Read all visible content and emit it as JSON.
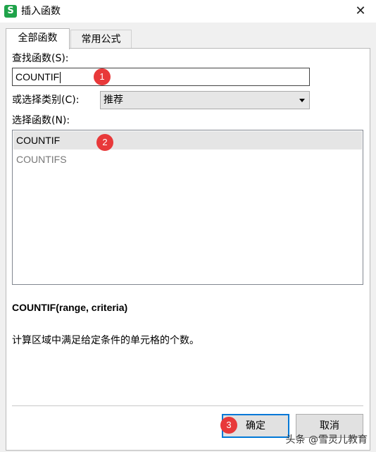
{
  "window": {
    "app_icon": "S",
    "title": "插入函数",
    "close_glyph": "✕"
  },
  "tabs": [
    {
      "label": "全部函数",
      "active": true
    },
    {
      "label": "常用公式",
      "active": false
    }
  ],
  "search": {
    "label": "查找函数(S):",
    "value": "COUNTIF"
  },
  "category": {
    "label": "或选择类别(C):",
    "selected": "推荐"
  },
  "function_list": {
    "label": "选择函数(N):",
    "items": [
      {
        "name": "COUNTIF",
        "selected": true
      },
      {
        "name": "COUNTIFS",
        "selected": false
      }
    ]
  },
  "signature": "COUNTIF(range, criteria)",
  "description": "计算区域中满足给定条件的单元格的个数。",
  "buttons": {
    "ok": "确定",
    "cancel": "取消"
  },
  "badges": [
    "1",
    "2",
    "3"
  ],
  "watermark": "头条 @雪灵儿教育",
  "colors": {
    "badge": "#e8393a",
    "focus_border": "#0078d7",
    "app_icon": "#1fa34a"
  }
}
